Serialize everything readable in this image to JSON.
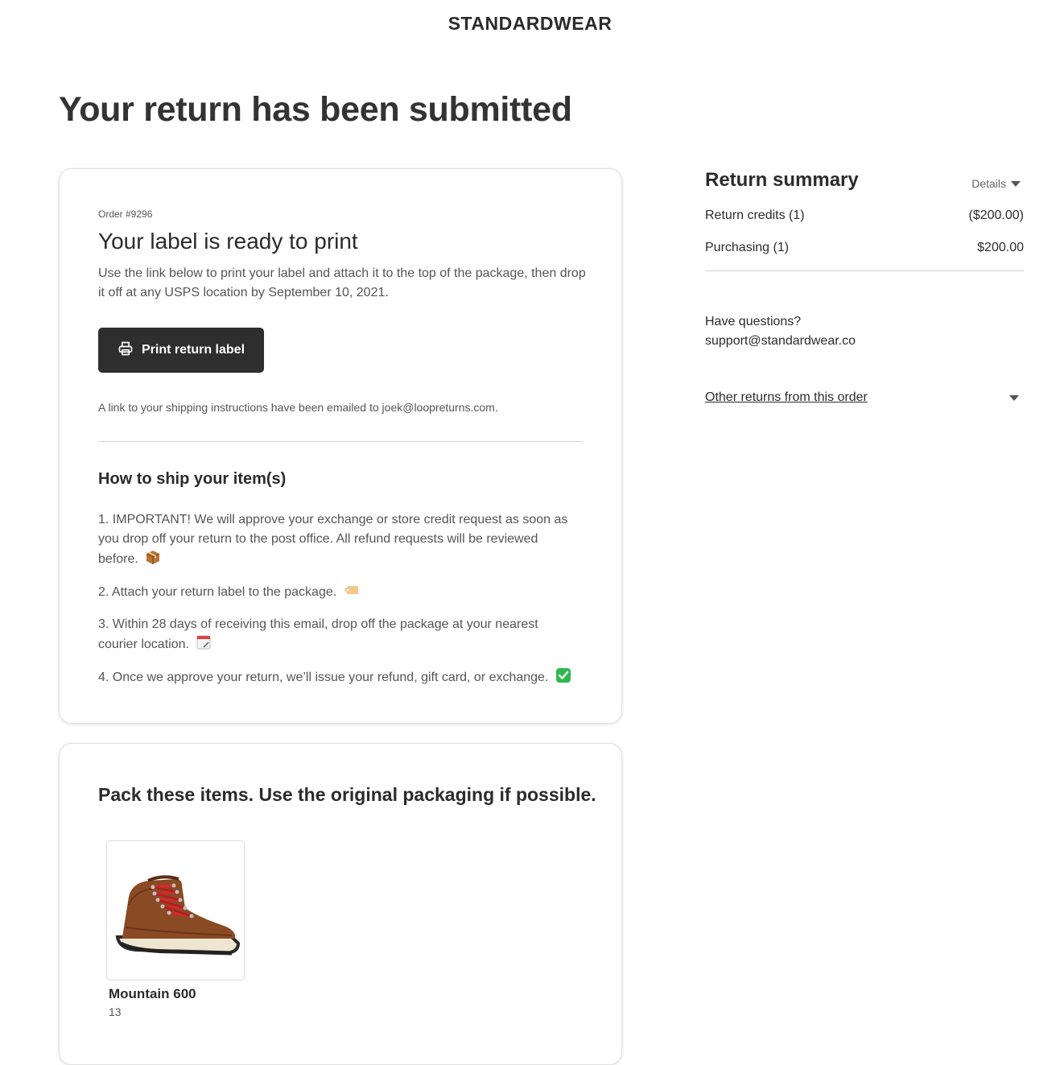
{
  "brand": "STANDARDWEAR",
  "page_title": "Your return has been submitted",
  "label_card": {
    "order_number": "Order #9296",
    "heading": "Your label is ready to print",
    "description": "Use the link below to print your label and attach it to the top of the package, then drop it off at any USPS location by September 10, 2021.",
    "print_button_label": "Print return label",
    "email_note": "A link to your shipping instructions have been emailed to joek@loopreturns.com.",
    "ship_heading": "How to ship your item(s)",
    "steps": [
      {
        "text": "1. IMPORTANT! We will approve your exchange or store credit request as soon as you drop off your return to the post office. All refund requests will be reviewed before.",
        "icon": "package-emoji-icon"
      },
      {
        "text": "2. Attach your return label to the package.",
        "icon": "label-tag-emoji-icon"
      },
      {
        "text": "3. Within 28 days of receiving this email, drop off the package at your nearest courier location.",
        "icon": "calendar-emoji-icon"
      },
      {
        "text": "4. Once we approve your return, we’ll issue your refund, gift card, or exchange.",
        "icon": "check-mark-emoji-icon"
      }
    ]
  },
  "pack_card": {
    "heading": "Pack these items. Use the original packaging if possible.",
    "items": [
      {
        "name": "Mountain 600",
        "size": "13",
        "image": "hiking-boot-image"
      }
    ]
  },
  "summary": {
    "title": "Return summary",
    "details_label": "Details",
    "rows": [
      {
        "label": "Return credits (1)",
        "value": "($200.00)"
      },
      {
        "label": "Purchasing (1)",
        "value": "$200.00"
      }
    ],
    "questions_label": "Have questions?",
    "support_email": "support@standardwear.co",
    "other_returns_label": "Other returns from this order"
  },
  "colors": {
    "button_bg": "#2e2e2e",
    "text_primary": "#2b2b2b",
    "text_secondary": "#555555"
  }
}
